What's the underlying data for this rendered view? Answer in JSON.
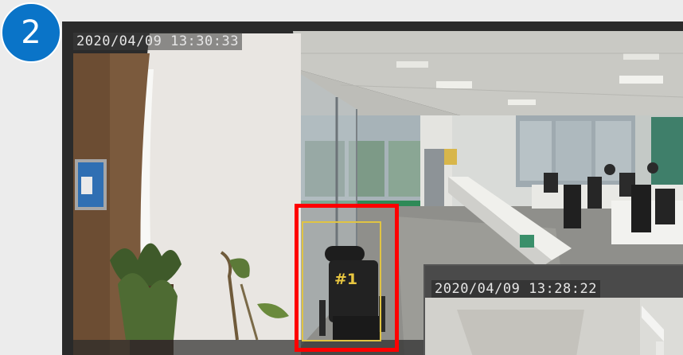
{
  "step_badge": {
    "number": "2",
    "color": "#0a74c8"
  },
  "main_camera": {
    "timestamp": "2020/04/09  13:30:33",
    "detection": {
      "label": "#1",
      "highlight_color": "#ff0000",
      "track_color": "#e0c443"
    }
  },
  "inset_camera": {
    "timestamp": "2020/04/09  13:28:22"
  }
}
